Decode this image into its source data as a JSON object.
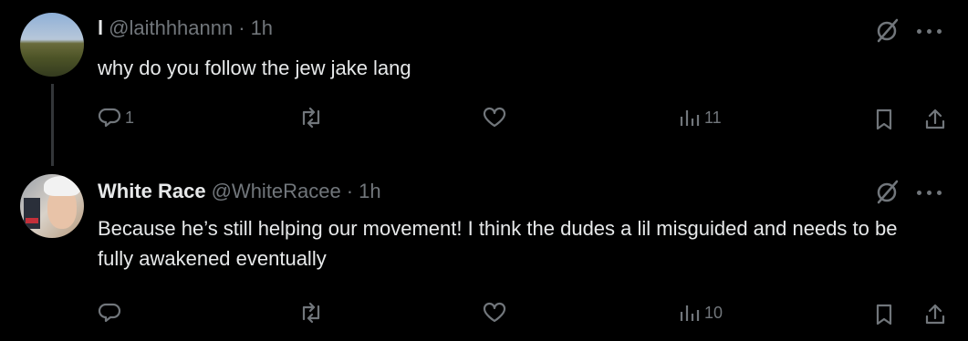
{
  "tweets": [
    {
      "name": "l",
      "handle": "@laithhhannn",
      "separator": "·",
      "time": "1h",
      "text": "why do you follow the jew jake lang",
      "actions": {
        "replies": "1",
        "retweets": "",
        "likes": "",
        "views": "11"
      }
    },
    {
      "name": "White Race",
      "handle": "@WhiteRacee",
      "separator": "·",
      "time": "1h",
      "text": "Because he’s still helping our movement! I think the dudes a lil misguided and needs to be fully awakened eventually",
      "actions": {
        "replies": "",
        "retweets": "",
        "likes": "",
        "views": "10"
      }
    }
  ],
  "icons": {
    "reply": "reply-icon",
    "retweet": "retweet-icon",
    "like": "heart-icon",
    "views": "views-icon",
    "bookmark": "bookmark-icon",
    "share": "share-icon",
    "grok": "grok-icon",
    "more": "more-icon"
  },
  "colors": {
    "background": "#000000",
    "text": "#e7e9ea",
    "muted": "#71767b"
  }
}
